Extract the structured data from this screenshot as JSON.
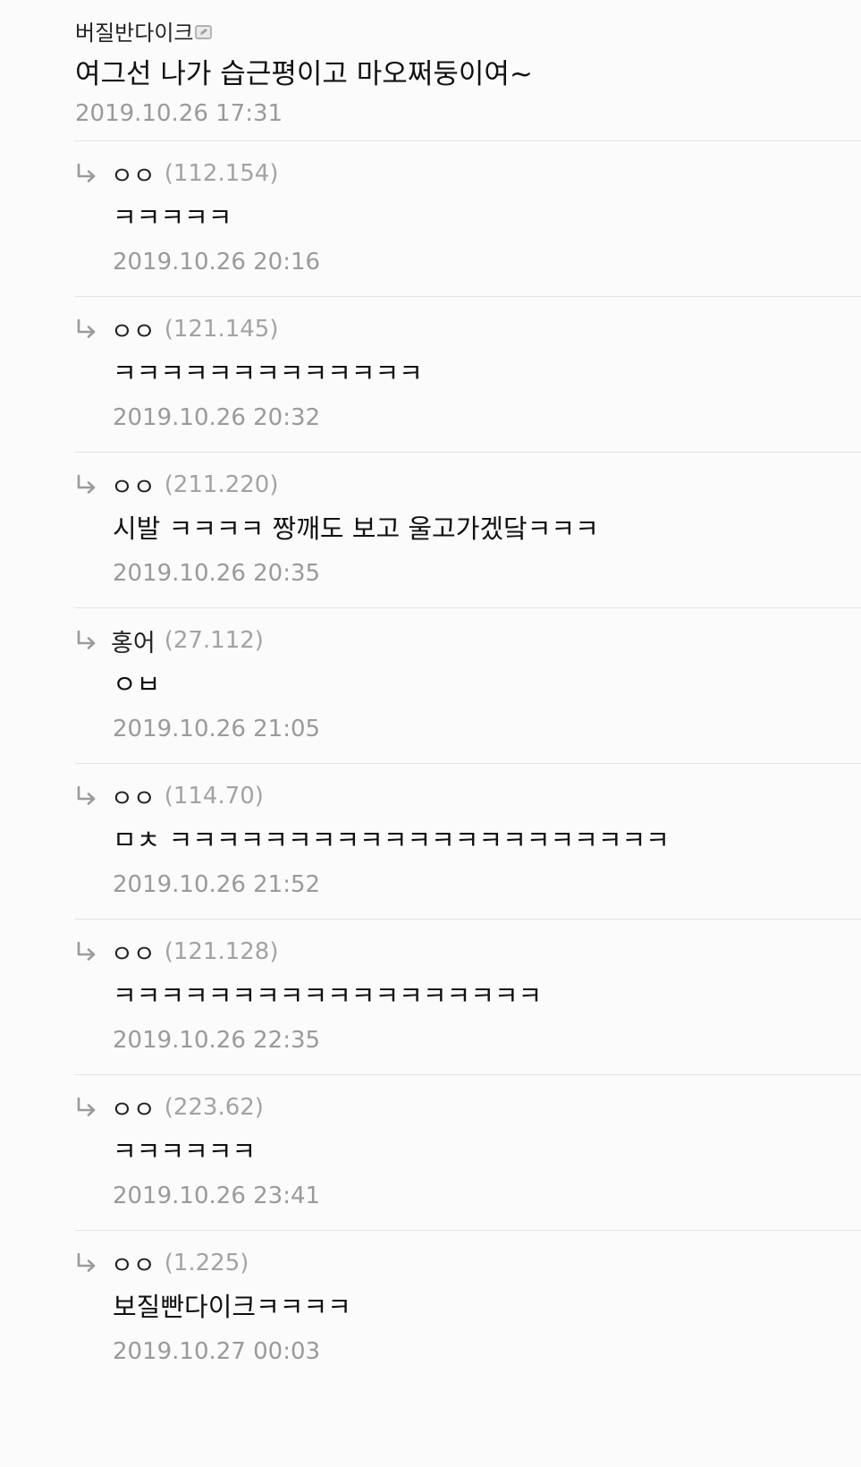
{
  "main_comment": {
    "author": "버질반다이크",
    "text": "여그선 나가 습근평이고 마오쩌둥이여~",
    "date": "2019.10.26 17:31"
  },
  "replies": [
    {
      "author": "ㅇㅇ",
      "ip": "(112.154)",
      "text": "ㅋㅋㅋㅋㅋ",
      "date": "2019.10.26 20:16"
    },
    {
      "author": "ㅇㅇ",
      "ip": "(121.145)",
      "text": "ㅋㅋㅋㅋㅋㅋㅋㅋㅋㅋㅋㅋㅋ",
      "date": "2019.10.26 20:32"
    },
    {
      "author": "ㅇㅇ",
      "ip": "(211.220)",
      "text": "시발 ㅋㅋㅋㅋ 짱깨도 보고 울고가겠닼ㅋㅋㅋ",
      "date": "2019.10.26 20:35"
    },
    {
      "author": "홍어",
      "ip": "(27.112)",
      "text": "ㅇㅂ",
      "date": "2019.10.26 21:05"
    },
    {
      "author": "ㅇㅇ",
      "ip": "(114.70)",
      "text": "ㅁㅊ ㅋㅋㅋㅋㅋㅋㅋㅋㅋㅋㅋㅋㅋㅋㅋㅋㅋㅋㅋㅋㅋ",
      "date": "2019.10.26 21:52"
    },
    {
      "author": "ㅇㅇ",
      "ip": "(121.128)",
      "text": "ㅋㅋㅋㅋㅋㅋㅋㅋㅋㅋㅋㅋㅋㅋㅋㅋㅋㅋ",
      "date": "2019.10.26 22:35"
    },
    {
      "author": "ㅇㅇ",
      "ip": "(223.62)",
      "text": "ㅋㅋㅋㅋㅋㅋ",
      "date": "2019.10.26 23:41"
    },
    {
      "author": "ㅇㅇ",
      "ip": "(1.225)",
      "text": "보질빤다이크ㅋㅋㅋㅋ",
      "date": "2019.10.27 00:03"
    }
  ],
  "icons": {
    "edit": "edit-icon",
    "reply": "reply-arrow-icon"
  },
  "colors": {
    "text": "#111111",
    "meta": "#9a9a9a",
    "divider": "#e4e4e4",
    "background": "#fbfbfb"
  }
}
